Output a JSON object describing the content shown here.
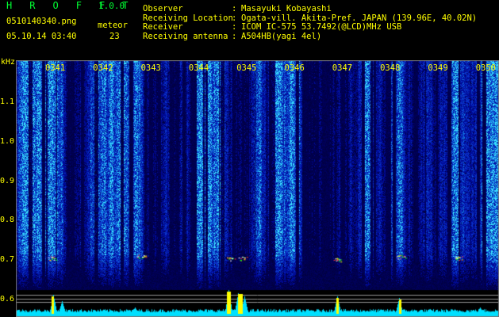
{
  "app": {
    "name": "H R O F F T",
    "version": "1.0.0"
  },
  "file": {
    "filename": "0510140340.png",
    "datetime": "05.10.14 03:40",
    "meteor_label": "meteor",
    "meteor_count": "23"
  },
  "info": [
    {
      "label": "Observer",
      "value": "Masayuki Kobayashi"
    },
    {
      "label": "Receiving Location",
      "value": "Ogata-vill. Akita-Pref. JAPAN (139.96E, 40.02N)"
    },
    {
      "label": "Receiver",
      "value": "ICOM IC-575 53.7492(@LCD)MHz USB"
    },
    {
      "label": "Receiving antenna",
      "value": "A504HB(yagi 4el)"
    }
  ],
  "colon": ":",
  "axis": {
    "unit": "kHz",
    "freq_labels": [
      "1.1",
      "1.0",
      "0.9",
      "0.8",
      "0.7",
      "0.6"
    ],
    "time_labels": [
      "0341",
      "0342",
      "0343",
      "0344",
      "0345",
      "0346",
      "0347",
      "0348",
      "0349",
      "0350"
    ]
  },
  "colors": {
    "text": "#ffff00",
    "title": "#00ff33",
    "background": "#000000",
    "spectrum_low": "#000090",
    "spectrum_high": "#00ffff",
    "echo_line": "#00ffff"
  }
}
